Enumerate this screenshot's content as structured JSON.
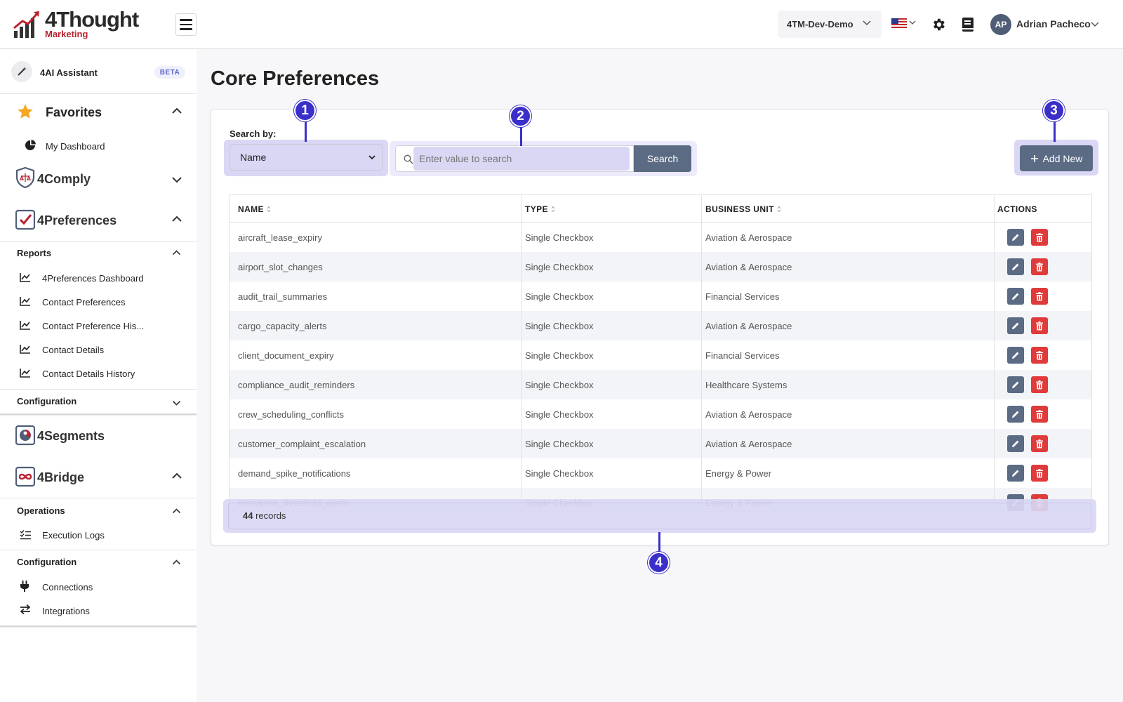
{
  "header": {
    "logo_name": "4Thought",
    "logo_sub": "Marketing",
    "environment": "4TM-Dev-Demo",
    "user_initials": "AP",
    "user_name": "Adrian Pacheco"
  },
  "sidebar": {
    "ai_assistant": "4AI Assistant",
    "ai_badge": "BETA",
    "favorites": {
      "title": "Favorites",
      "items": [
        "My Dashboard"
      ]
    },
    "comply": {
      "title": "4Comply"
    },
    "preferences": {
      "title": "4Preferences",
      "reports_label": "Reports",
      "reports": [
        "4Preferences Dashboard",
        "Contact Preferences",
        "Contact Preference His...",
        "Contact Details",
        "Contact Details History"
      ],
      "configuration_label": "Configuration"
    },
    "segments": {
      "title": "4Segments"
    },
    "bridge": {
      "title": "4Bridge",
      "operations_label": "Operations",
      "operations": [
        "Execution Logs"
      ],
      "configuration_label": "Configuration",
      "configuration": [
        "Connections",
        "Integrations"
      ]
    }
  },
  "main": {
    "page_title": "Core Preferences",
    "search_by_label": "Search by:",
    "search_by_value": "Name",
    "search_placeholder": "Enter value to search",
    "search_button": "Search",
    "add_new_button": "Add New",
    "columns": [
      "NAME",
      "TYPE",
      "BUSINESS UNIT",
      "ACTIONS"
    ],
    "rows": [
      {
        "name": "aircraft_lease_expiry",
        "type": "Single Checkbox",
        "unit": "Aviation & Aerospace"
      },
      {
        "name": "airport_slot_changes",
        "type": "Single Checkbox",
        "unit": "Aviation & Aerospace"
      },
      {
        "name": "audit_trail_summaries",
        "type": "Single Checkbox",
        "unit": "Financial Services"
      },
      {
        "name": "cargo_capacity_alerts",
        "type": "Single Checkbox",
        "unit": "Aviation & Aerospace"
      },
      {
        "name": "client_document_expiry",
        "type": "Single Checkbox",
        "unit": "Financial Services"
      },
      {
        "name": "compliance_audit_reminders",
        "type": "Single Checkbox",
        "unit": "Healthcare Systems"
      },
      {
        "name": "crew_scheduling_conflicts",
        "type": "Single Checkbox",
        "unit": "Aviation & Aerospace"
      },
      {
        "name": "customer_complaint_escalation",
        "type": "Single Checkbox",
        "unit": "Aviation & Aerospace"
      },
      {
        "name": "demand_spike_notifications",
        "type": "Single Checkbox",
        "unit": "Energy & Power"
      },
      {
        "name": "emissions_threshold_alerts",
        "type": "Single Checkbox",
        "unit": "Energy & Power"
      }
    ],
    "record_count": "44",
    "record_suffix": " records"
  },
  "callouts": [
    "1",
    "2",
    "3",
    "4"
  ],
  "colors": {
    "accent": "#3b2fc9",
    "highlight": "#d9d7f4",
    "button": "#5b6b84",
    "delete": "#e03a3a",
    "brand_red": "#b8232f"
  }
}
